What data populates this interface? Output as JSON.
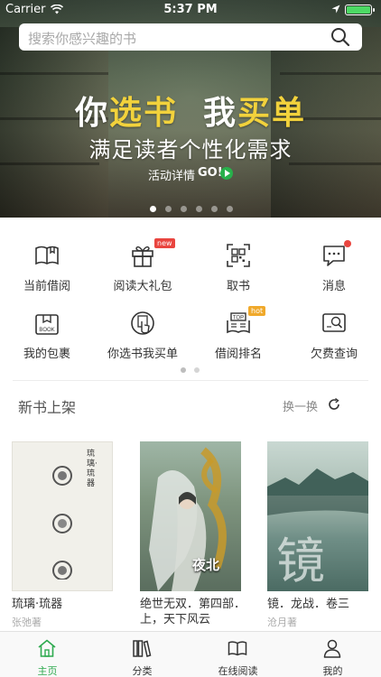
{
  "status_bar": {
    "carrier": "Carrier",
    "time": "5:37 PM"
  },
  "search": {
    "placeholder": "搜索你感兴趣的书"
  },
  "banner": {
    "title_part1": "你",
    "title_highlight1": "选书",
    "title_part2": "我",
    "title_highlight2": "买单",
    "subtitle": "满足读者个性化需求",
    "activity_link": "活动详情",
    "go_label": "GO!",
    "highlight_color": "#f2d23c",
    "slide_count": 6,
    "active_slide": 1
  },
  "features": [
    {
      "label": "当前借阅",
      "icon": "open-book-icon"
    },
    {
      "label": "阅读大礼包",
      "icon": "gift-icon",
      "badge": "new"
    },
    {
      "label": "取书",
      "icon": "qr-code-icon"
    },
    {
      "label": "消息",
      "icon": "message-icon",
      "badge_dot": true
    },
    {
      "label": "我的包裹",
      "icon": "package-icon"
    },
    {
      "label": "你选书我买单",
      "icon": "tap-select-icon"
    },
    {
      "label": "借阅排名",
      "icon": "ranking-icon",
      "badge": "hot"
    },
    {
      "label": "欠费查询",
      "icon": "fee-query-icon"
    }
  ],
  "feature_pages": {
    "count": 2,
    "active": 1
  },
  "new_books": {
    "title": "新书上架",
    "refresh_label": "换一换",
    "books": [
      {
        "title": "琉璃·琉器",
        "author": "张弛著",
        "cover_text": "琉璃·琉器"
      },
      {
        "title": "绝世无双．第四部．上，天下风云",
        "author": "",
        "cover_text": "夜北"
      },
      {
        "title": "镜．龙战．卷三",
        "author": "沧月著",
        "cover_text": "镜"
      }
    ]
  },
  "tabs": [
    {
      "label": "主页",
      "icon": "home-icon",
      "active": true
    },
    {
      "label": "分类",
      "icon": "category-books-icon"
    },
    {
      "label": "在线阅读",
      "icon": "online-reading-icon"
    },
    {
      "label": "我的",
      "icon": "profile-icon"
    }
  ],
  "colors": {
    "accent": "#2eaa4f",
    "badge_new": "#e9453f",
    "badge_hot": "#f0a92b"
  }
}
